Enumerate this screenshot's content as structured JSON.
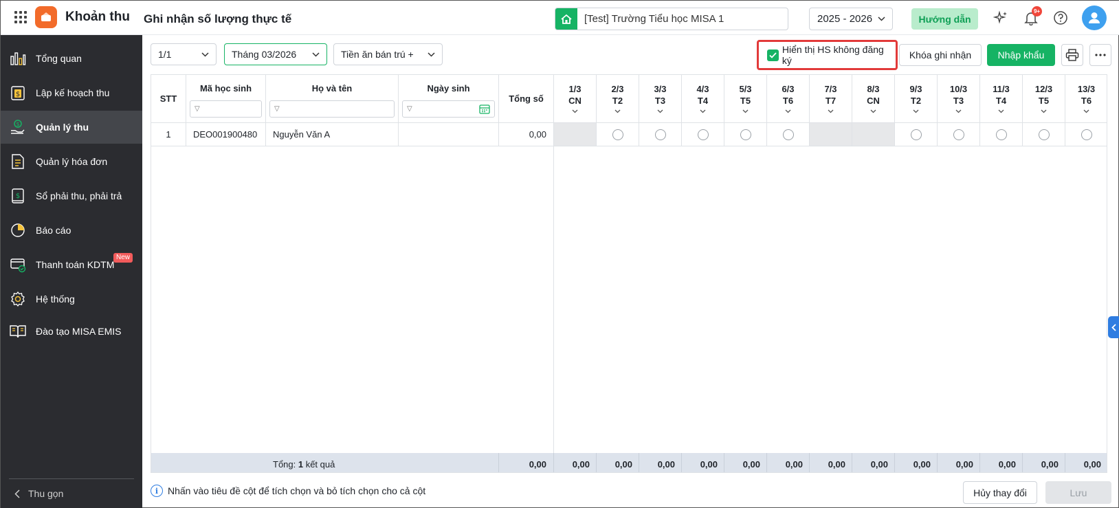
{
  "header": {
    "app_name": "Khoản thu",
    "page_title": "Ghi nhận số lượng thực tế",
    "school": "[Test] Trường Tiểu học MISA 1",
    "year": "2025 - 2026",
    "guide_label": "Hướng dẫn",
    "notification_count": "9+"
  },
  "sidebar": {
    "items": [
      {
        "label": "Tổng quan",
        "icon": "bar-chart-icon"
      },
      {
        "label": "Lập kế hoạch thu",
        "icon": "dollar-doc-icon"
      },
      {
        "label": "Quản lý thu",
        "icon": "hand-money-icon"
      },
      {
        "label": "Quản lý hóa đơn",
        "icon": "invoice-icon"
      },
      {
        "label": "Sổ phải thu, phải trả",
        "icon": "ledger-icon"
      },
      {
        "label": "Báo cáo",
        "icon": "pie-chart-icon"
      },
      {
        "label": "Thanh toán KDTM",
        "icon": "card-icon",
        "badge": "New"
      },
      {
        "label": "Hệ thống",
        "icon": "gear-icon"
      },
      {
        "label": "Đào tạo MISA EMIS",
        "icon": "book-icon"
      }
    ],
    "active": "Quản lý thu",
    "collapse_label": "Thu gọn"
  },
  "filters": {
    "class": "1/1",
    "month": "Tháng 03/2026",
    "fee": "Tiền ăn bán trú +"
  },
  "toolbar": {
    "show_unregistered_label": "Hiển thị HS không đăng ký",
    "show_unregistered_checked": true,
    "lock_label": "Khóa ghi nhận",
    "import_label": "Nhập khẩu"
  },
  "table": {
    "headers": {
      "stt": "STT",
      "code": "Mã học sinh",
      "name": "Họ và tên",
      "dob": "Ngày sinh",
      "total": "Tổng số"
    },
    "days": [
      {
        "date": "1/3",
        "dow": "CN",
        "off": true
      },
      {
        "date": "2/3",
        "dow": "T2",
        "off": false
      },
      {
        "date": "3/3",
        "dow": "T3",
        "off": false
      },
      {
        "date": "4/3",
        "dow": "T4",
        "off": false
      },
      {
        "date": "5/3",
        "dow": "T5",
        "off": false
      },
      {
        "date": "6/3",
        "dow": "T6",
        "off": false
      },
      {
        "date": "7/3",
        "dow": "T7",
        "off": true
      },
      {
        "date": "8/3",
        "dow": "CN",
        "off": true
      },
      {
        "date": "9/3",
        "dow": "T2",
        "off": false
      },
      {
        "date": "10/3",
        "dow": "T3",
        "off": false
      },
      {
        "date": "11/3",
        "dow": "T4",
        "off": false
      },
      {
        "date": "12/3",
        "dow": "T5",
        "off": false
      },
      {
        "date": "13/3",
        "dow": "T6",
        "off": false
      }
    ],
    "rows": [
      {
        "stt": "1",
        "code": "DEO001900480",
        "name": "Nguyễn Văn A",
        "dob": "",
        "total": "0,00"
      }
    ],
    "footer": {
      "summary_prefix": "Tổng: ",
      "summary_count": "1",
      "summary_suffix": " kết quả",
      "total": "0,00",
      "day_totals": [
        "0,00",
        "0,00",
        "0,00",
        "0,00",
        "0,00",
        "0,00",
        "0,00",
        "0,00",
        "0,00",
        "0,00",
        "0,00",
        "0,00",
        "0,00"
      ]
    }
  },
  "bottom": {
    "hint": "Nhấn vào tiêu đề cột để tích chọn và bỏ tích chọn cho cả cột",
    "cancel_label": "Hủy thay đổi",
    "save_label": "Lưu"
  },
  "colors": {
    "accent": "#16b364",
    "sidebar_bg": "#2b2c30",
    "highlight_border": "#e23a3a",
    "brand_orange": "#f26b2a"
  }
}
